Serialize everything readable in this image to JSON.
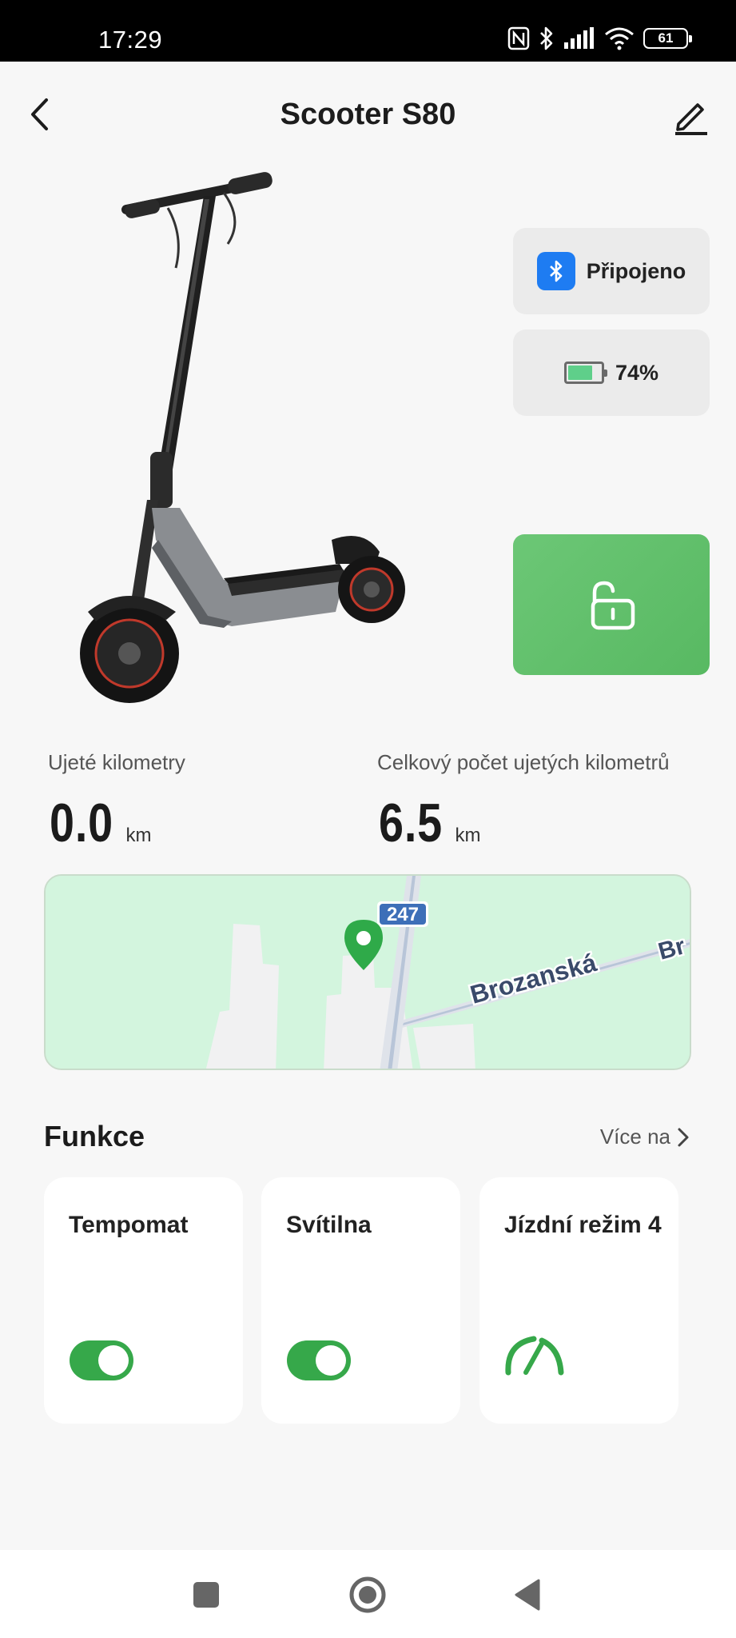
{
  "status_bar": {
    "time": "17:29",
    "battery_level": "61",
    "icons": [
      "nfc-icon",
      "bluetooth-icon",
      "signal-icon",
      "wifi-icon",
      "battery-icon"
    ]
  },
  "header": {
    "title": "Scooter S80",
    "back_icon": "chevron-left-icon",
    "edit_icon": "pencil-icon"
  },
  "device": {
    "connection_status": "Připojeno",
    "battery_percent": "74%",
    "battery_fraction": 0.74,
    "lock_state_icon": "unlocked-padlock-icon"
  },
  "stats": {
    "trip_label": "Ujeté kilometry",
    "trip_value": "0.0",
    "trip_unit": "km",
    "total_label": "Celkový počet ujetých kilometrů",
    "total_value": "6.5",
    "total_unit": "km"
  },
  "map": {
    "road_number": "247",
    "street_name": "Brozanská",
    "street_name_cut": "Br"
  },
  "functions": {
    "title": "Funkce",
    "more_label": "Více na",
    "items": [
      {
        "label": "Tempomat",
        "enabled": true
      },
      {
        "label": "Svítilna",
        "enabled": true
      },
      {
        "label": "Jízdní režim 4",
        "icon": "speedometer-icon"
      }
    ]
  },
  "colors": {
    "accent_green": "#36a84a",
    "bluetooth_blue": "#1e7cf2",
    "lock_green": "#62c06c",
    "map_green": "#d3f5de"
  }
}
